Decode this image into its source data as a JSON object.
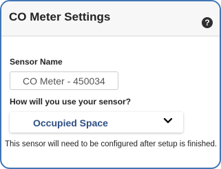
{
  "panel": {
    "title": "CO Meter Settings",
    "help_icon": "question-circle-icon",
    "help_glyph": "?"
  },
  "sensor_name": {
    "label": "Sensor Name",
    "value": "CO Meter - 450034"
  },
  "usage": {
    "label": "How will you use your sensor?",
    "selected": "Occupied Space",
    "chevron_icon": "chevron-down-icon"
  },
  "note": "This sensor will need to be configured after setup is finished.",
  "colors": {
    "border": "#3f76b5",
    "select_text": "#2c4f82",
    "header_bg": "#f7f7f7"
  }
}
